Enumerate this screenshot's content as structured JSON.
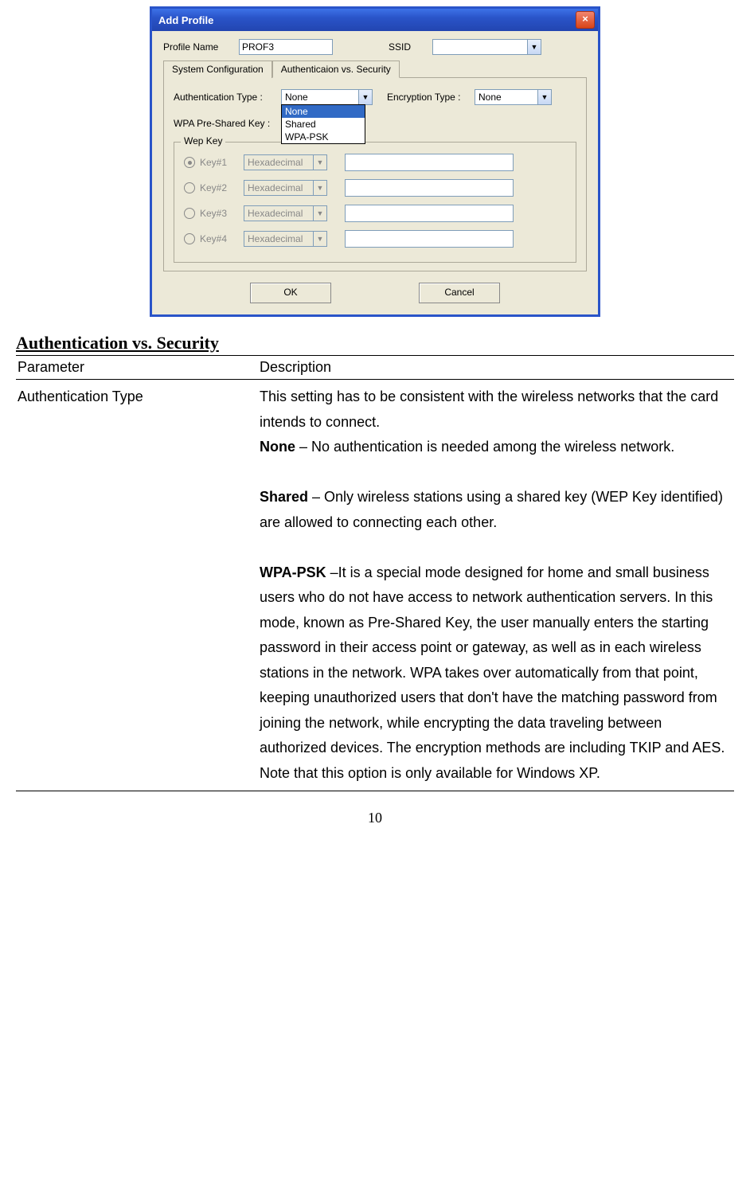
{
  "dialog": {
    "title": "Add Profile",
    "profile_name_label": "Profile Name",
    "profile_name_value": "PROF3",
    "ssid_label": "SSID",
    "ssid_value": "",
    "tabs": {
      "sys": "System Configuration",
      "auth": "Authenticaion vs. Security"
    },
    "auth_type_label": "Authentication Type :",
    "auth_type_value": "None",
    "auth_type_options": [
      "None",
      "Shared",
      "WPA-PSK"
    ],
    "enc_type_label": "Encryption Type :",
    "enc_type_value": "None",
    "wpa_label": "WPA Pre-Shared Key :",
    "wep_legend": "Wep Key",
    "keys": [
      {
        "label": "Key#1",
        "format": "Hexadecimal",
        "selected": true
      },
      {
        "label": "Key#2",
        "format": "Hexadecimal",
        "selected": false
      },
      {
        "label": "Key#3",
        "format": "Hexadecimal",
        "selected": false
      },
      {
        "label": "Key#4",
        "format": "Hexadecimal",
        "selected": false
      }
    ],
    "ok": "OK",
    "cancel": "Cancel"
  },
  "doc": {
    "section_title": "Authentication vs. Security",
    "col_param": "Parameter",
    "col_desc": "Description",
    "row_param": "Authentication Type",
    "intro": "This setting has to be consistent with the wireless networks that the card intends to connect.",
    "none_label": "None",
    "none_text": " – No authentication is needed among the wireless network.",
    "shared_label": "Shared",
    "shared_text": " – Only wireless stations using a shared key (WEP Key identified) are allowed to connecting each other.",
    "wpa_label": "WPA-PSK",
    "wpa_text": " –It is a special mode designed for home and small business users who do not have access to network authentication servers. In this mode, known as Pre-Shared Key, the user manually enters the starting password in their access point or gateway, as well as in each wireless stations in the network. WPA takes over automatically from that point, keeping unauthorized users that don't have the matching password from joining the network, while encrypting the data traveling between authorized devices. The encryption methods are including TKIP and AES. Note that this option is only available for Windows XP."
  },
  "page_number": "10"
}
